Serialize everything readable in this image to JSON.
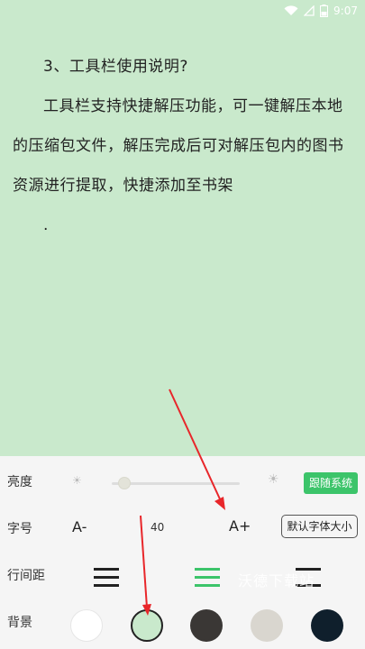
{
  "status_bar": {
    "time": "9:07",
    "icons": [
      "wifi-icon",
      "signal-icon",
      "battery-icon"
    ]
  },
  "reader": {
    "heading": "3、工具栏使用说明?",
    "para1": "工具栏支持快捷解压功能，可一键解压本地",
    "para2": "的压缩包文件，解压完成后可对解压包内的图书",
    "para3": "资源进行提取，快捷添加至书架",
    "trailing": "."
  },
  "settings": {
    "brightness": {
      "label": "亮度",
      "low_icon": "sun-small-icon",
      "high_icon": "sun-large-icon",
      "level": 0.1,
      "follow_system_label": "跟随系统"
    },
    "font_size": {
      "label": "字号",
      "decrease": "A-",
      "value": "40",
      "increase": "A+",
      "default_label": "默认字体大小"
    },
    "line_spacing": {
      "label": "行间距",
      "options": [
        "wide",
        "medium",
        "narrow"
      ],
      "selected_index": 1
    },
    "background": {
      "label": "背景",
      "colors": [
        "#ffffff",
        "#c9e9cc",
        "#3a3735",
        "#d9d6cf",
        "#0f1f2c"
      ],
      "selected_index": 1
    }
  },
  "watermark": "沃德下载站",
  "colors": {
    "accent": "#3cc46a",
    "page_background": "#c9e9cc",
    "panel_background": "#f5f5f5",
    "annotation_arrow": "#e8262a"
  }
}
